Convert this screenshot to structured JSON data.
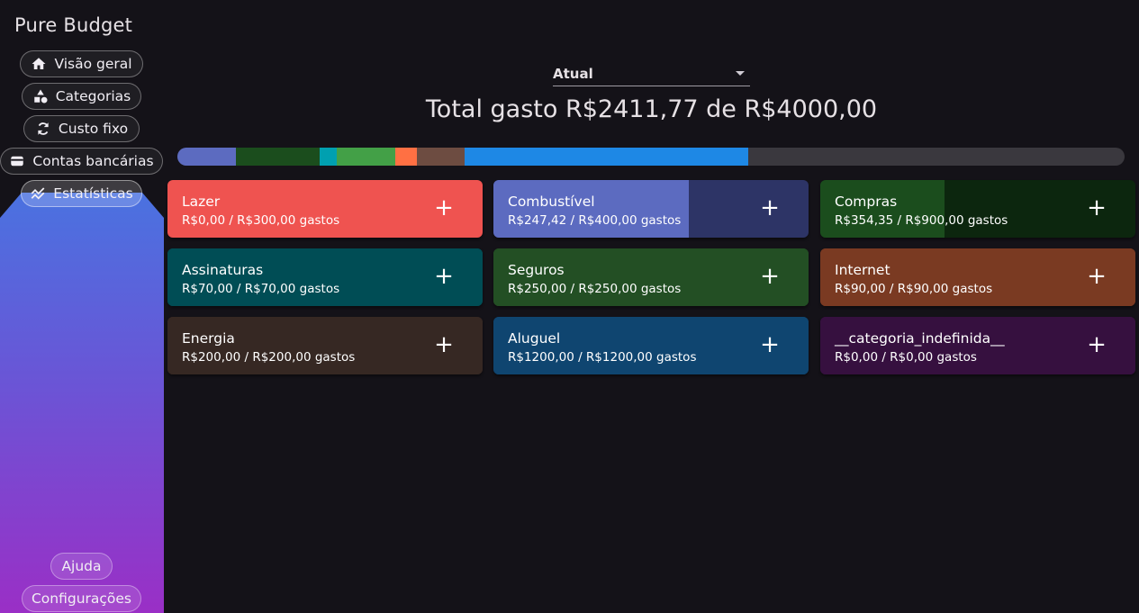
{
  "app": {
    "title": "Pure Budget"
  },
  "nav": {
    "items": [
      {
        "label": "Visão geral",
        "icon": "home-icon"
      },
      {
        "label": "Categorias",
        "icon": "shapes-icon"
      },
      {
        "label": "Custo fixo",
        "icon": "refresh-icon"
      },
      {
        "label": "Contas bancárias",
        "icon": "wallet-icon"
      },
      {
        "label": "Estatísticas",
        "icon": "chart-line-icon",
        "active": true
      }
    ],
    "bottom": [
      {
        "label": "Ajuda"
      },
      {
        "label": "Configurações"
      }
    ]
  },
  "period": {
    "selected": "Atual"
  },
  "summary": {
    "text": "Total gasto R$2411,77 de R$4000,00",
    "spent": 2411.77,
    "budget": 4000.0
  },
  "budget_bar": {
    "track_color": "#3a383e",
    "segments": [
      {
        "color": "#5c6bc0",
        "value": 247.42
      },
      {
        "color": "#1b4d1d",
        "value": 354.35
      },
      {
        "color": "#00a0b0",
        "value": 70
      },
      {
        "color": "#43a047",
        "value": 250
      },
      {
        "color": "#ff7043",
        "value": 90
      },
      {
        "color": "#6d4c41",
        "value": 200
      },
      {
        "color": "#1e88e5",
        "value": 1200
      }
    ]
  },
  "categories": [
    {
      "name": "Lazer",
      "spent_text": "R$0,00 / R$300,00 gastos",
      "spent_fraction": 0,
      "base_color": "#ef5350",
      "fill_color": "#ef5350"
    },
    {
      "name": "Combustível",
      "spent_text": "R$247,42 / R$400,00 gastos",
      "spent_fraction": 0.6186,
      "base_color": "#2d3466",
      "fill_color": "#5c6bc0"
    },
    {
      "name": "Compras",
      "spent_text": "R$354,35 / R$900,00 gastos",
      "spent_fraction": 0.3937,
      "base_color": "#0c260e",
      "fill_color": "#1b4d1d"
    },
    {
      "name": "Assinaturas",
      "spent_text": "R$70,00 / R$70,00 gastos",
      "spent_fraction": 1,
      "base_color": "#004d55",
      "fill_color": "#004d55"
    },
    {
      "name": "Seguros",
      "spent_text": "R$250,00 / R$250,00 gastos",
      "spent_fraction": 1,
      "base_color": "#234f24",
      "fill_color": "#234f24"
    },
    {
      "name": "Internet",
      "spent_text": "R$90,00 / R$90,00 gastos",
      "spent_fraction": 1,
      "base_color": "#7a3a22",
      "fill_color": "#7a3a22"
    },
    {
      "name": "Energia",
      "spent_text": "R$200,00 / R$200,00 gastos",
      "spent_fraction": 1,
      "base_color": "#362823",
      "fill_color": "#362823"
    },
    {
      "name": "Aluguel",
      "spent_text": "R$1200,00 / R$1200,00 gastos",
      "spent_fraction": 1,
      "base_color": "#0f4570",
      "fill_color": "#0f4570"
    },
    {
      "name": "__categoria_indefinida__",
      "spent_text": "R$0,00 / R$0,00 gastos",
      "spent_fraction": 1,
      "base_color": "#36103f",
      "fill_color": "#36103f"
    }
  ],
  "add_label": "+"
}
